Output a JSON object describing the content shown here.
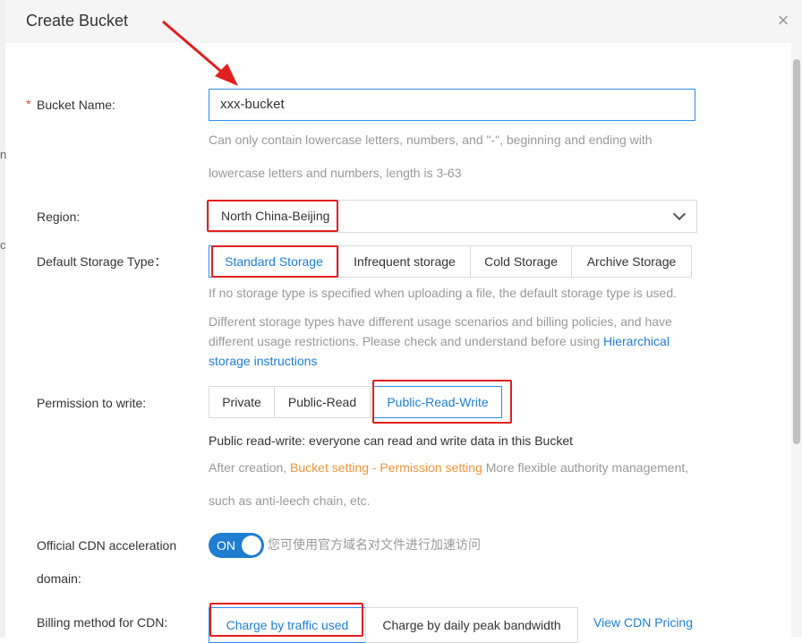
{
  "dialog": {
    "title": "Create Bucket",
    "close_symbol": "×"
  },
  "edge": {
    "mark1": "n",
    "mark2": "c"
  },
  "bucket_name": {
    "required_mark": "*",
    "label": "Bucket Name:",
    "value": "xxx-bucket",
    "hint_line1": "Can only contain lowercase letters, numbers, and \"-\", beginning and ending with",
    "hint_line2": "lowercase letters and numbers, length is 3-63"
  },
  "region": {
    "label": "Region:",
    "value": "North China-Beijing"
  },
  "storage_type": {
    "label": "Default Storage Type：",
    "options": [
      "Standard Storage",
      "Infrequent storage",
      "Cold Storage",
      "Archive Storage"
    ],
    "selected": "Standard Storage",
    "hint1": "If no storage type is specified when uploading a file, the default storage type is used.",
    "hint2_line1": "Different storage types have different usage scenarios and billing policies, and have",
    "hint2_line2_text": "different usage restrictions. Please check and understand before using ",
    "hint2_link_part1": "Hierarchical",
    "hint2_link_part2": "storage instructions"
  },
  "permission": {
    "label": "Permission to write:",
    "options": [
      "Private",
      "Public-Read",
      "Public-Read-Write"
    ],
    "selected": "Public-Read-Write",
    "desc": "Public read-write: everyone can read and write data in this Bucket",
    "after_prefix": "After creation, ",
    "after_link": "Bucket setting - Permission setting",
    "after_suffix": " More flexible authority management,",
    "after_line2": "such as anti-leech chain, etc."
  },
  "cdn": {
    "label_line1": "Official CDN acceleration",
    "label_line2": "domain:",
    "toggle_label": "ON",
    "toggle_on": true,
    "toggle_hint": "您可使用官方域名对文件进行加速访问"
  },
  "billing": {
    "label": "Billing method for CDN:",
    "options": [
      "Charge by traffic used",
      "Charge by daily peak bandwidth"
    ],
    "selected": "Charge by traffic used",
    "pricing_link": "View CDN Pricing"
  },
  "colors": {
    "accent": "#1f7ed0",
    "annotation_red": "#e02020",
    "link_orange": "#f0953b"
  }
}
